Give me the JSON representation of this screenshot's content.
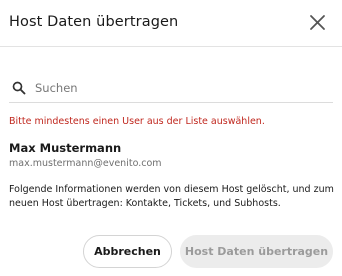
{
  "dialog": {
    "title": "Host Daten übertragen",
    "close_icon": "close-icon"
  },
  "search": {
    "icon": "search-icon",
    "placeholder": "Suchen",
    "value": ""
  },
  "error_message": "Bitte mindestens einen User aus der Liste auswählen.",
  "user": {
    "name": "Max Mustermann",
    "email": "max.mustermann@evenito.com"
  },
  "info_text": "Folgende Informationen werden von diesem Host gelöscht, und zum neuen Host übertragen: Kontakte, Tickets, und Subhosts.",
  "buttons": {
    "cancel_label": "Abbrechen",
    "submit_label": "Host Daten übertragen",
    "submit_disabled": true
  },
  "colors": {
    "error": "#c0271e",
    "disabled_bg": "#ececec",
    "disabled_text": "#9b9b9b"
  }
}
